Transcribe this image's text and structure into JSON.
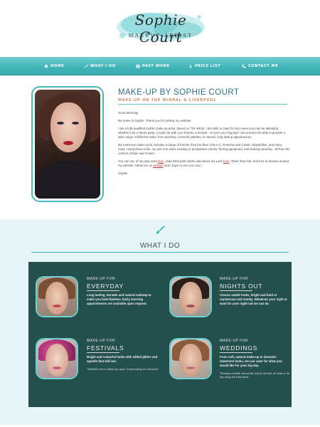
{
  "logo": {
    "name": "Sophie Court",
    "subtitle": "MAKEUP ARTIST",
    "accent": "#7fd3d6"
  },
  "nav": {
    "items": [
      {
        "label": "HOME",
        "icon": "home-icon"
      },
      {
        "label": "WHAT I DO",
        "icon": "brush-icon"
      },
      {
        "label": "PAST WORK",
        "icon": "camera-icon"
      },
      {
        "label": "PRICE LIST",
        "icon": "pound-icon"
      },
      {
        "label": "CONTACT ME",
        "icon": "phone-icon"
      }
    ]
  },
  "intro": {
    "title": "MAKE-UP BY SOPHIE COURT",
    "subtitle": "MAKE-UP ON THE WIRRAL & LIVERPOOL",
    "greeting": "Good Morning!",
    "p1": "My name is Sophie. Thank you for visiting my website.",
    "p2": "I am a fully qualified mobile make-up artist, based on The Wirral. I am able to cater for any event you may be attending - whether it be a family party, a night out with your friends, a festival - or even your big day! I am proud to be able to provide a wide range of different looks, from dazzling, colourful palettes, to natural, long-lasting appearances.",
    "p3": "My extensive make-up kit includes a range of brands from the likes of M.A.C, Peaches and Cream, Maybelline, and many more. Using these tools, my aim is to leave existing or perspective clients, feeling pampered, and looking amazing - all from the comfort of their own home!",
    "p4_pre": "You can see of my past work ",
    "p4_link1": "here",
    "p4_mid": ", read what past clients said about my work ",
    "p4_link2": "here",
    "p4_mid2": ". Other than that, feel free to browse around my website, follow me on ",
    "p4_link3": "website",
    "p4_post": " and I hope to see you soon.",
    "signoff": "Sophie"
  },
  "what_i_do": {
    "title": "WHAT I DO",
    "cards": [
      {
        "label": "MAKE-UP FOR",
        "heading": "EVERYDAY",
        "text": "Long lasting, durable and natural makeup to make you look flawless. Early morning appointments are available upon request.",
        "note": ""
      },
      {
        "label": "MAKE-UP FOR",
        "heading": "NIGHTS OUT",
        "text": "Classic subtle looks, bright and bold or mysterious and smoky. Whatever your style or want for your night out we can do.",
        "note": ""
      },
      {
        "label": "MAKE-UP FOR",
        "heading": "FESTIVALS",
        "text": "Bright and colourful looks with added glitter and sparkle that will last.",
        "note": "*Available with or without face gems. Group bookings are discounted"
      },
      {
        "label": "MAKE-UP FOR",
        "heading": "WEDDINGS",
        "text": "From soft, natural make-up to dramatic statement looks, we can cater for what you would like for your big day.",
        "note": "*Packages available that include trial for the bride, the bride on the day, along with bridesmaids"
      }
    ]
  },
  "colors": {
    "nav": "#3fb4b8",
    "panel": "#234f4d",
    "title": "#2f6f86",
    "subtitle": "#c98a6a",
    "section_bg": "#e8f5f8"
  }
}
